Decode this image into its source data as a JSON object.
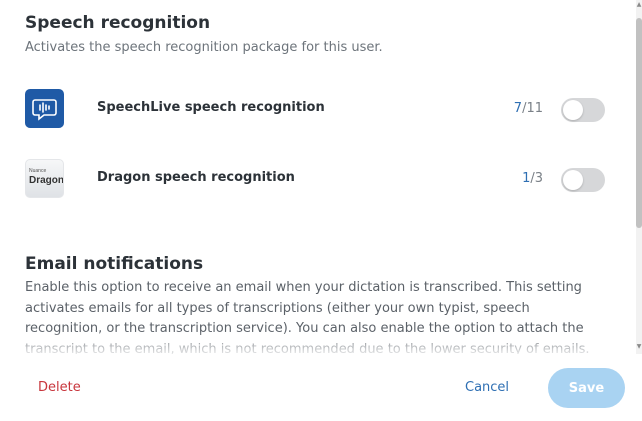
{
  "speech": {
    "title": "Speech recognition",
    "subtitle": "Activates the speech recognition package for this user.",
    "items": [
      {
        "label": "SpeechLive speech recognition",
        "used": "7",
        "total": "/11",
        "enabled": false,
        "icon": "speechlive-logo-icon"
      },
      {
        "label": "Dragon speech recognition",
        "used": "1",
        "total": "/3",
        "enabled": false,
        "icon": "dragon-logo-icon",
        "logo_top": "Nuance",
        "logo_main": "Dragon"
      }
    ]
  },
  "email": {
    "title": "Email notifications",
    "description": "Enable this option to receive an email when your dictation is transcribed. This setting activates emails for all types of transcriptions (either your own typist, speech recognition, or the transcription service). You can also enable the option to attach the transcript to the email, which is not recommended due to the lower security of emails."
  },
  "footer": {
    "delete_label": "Delete",
    "cancel_label": "Cancel",
    "save_label": "Save"
  },
  "colors": {
    "accent": "#2e6fb3",
    "danger": "#c8363d",
    "save_disabled": "#a9d3f2",
    "toggle_off": "#d6d7d9"
  }
}
